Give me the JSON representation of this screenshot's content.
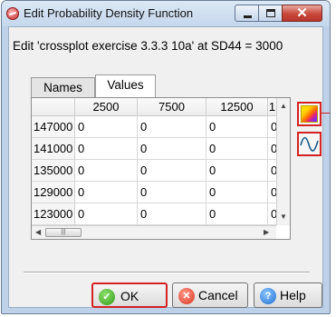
{
  "window": {
    "title": "Edit Probability Density Function",
    "close_glyph": "✕"
  },
  "dialog": {
    "heading": "Edit 'crossplot exercise 3.3.3 10a' at SD44 = 3000"
  },
  "tabs": [
    {
      "label": "Names",
      "selected": false
    },
    {
      "label": "Values",
      "selected": true
    }
  ],
  "table": {
    "columns": [
      "",
      "2500",
      "7500",
      "12500",
      "1"
    ],
    "rows": [
      {
        "label": "147000",
        "cells": [
          "0",
          "0",
          "0",
          "0"
        ]
      },
      {
        "label": "141000",
        "cells": [
          "0",
          "0",
          "0",
          "0"
        ]
      },
      {
        "label": "135000",
        "cells": [
          "0",
          "0",
          "0",
          "0"
        ]
      },
      {
        "label": "129000",
        "cells": [
          "0",
          "0",
          "0",
          "0"
        ]
      },
      {
        "label": "123000",
        "cells": [
          "0",
          "0",
          "0",
          "0"
        ]
      }
    ]
  },
  "side_buttons": [
    {
      "icon": "density-plot-icon"
    },
    {
      "icon": "sine-curve-icon"
    }
  ],
  "buttons": {
    "ok": "OK",
    "cancel": "Cancel",
    "help": "Help"
  },
  "colors": {
    "highlight": "#d42222",
    "ok_icon": "#2e9a1b",
    "cancel_icon": "#d8331f",
    "help_icon": "#1e6fd0"
  }
}
